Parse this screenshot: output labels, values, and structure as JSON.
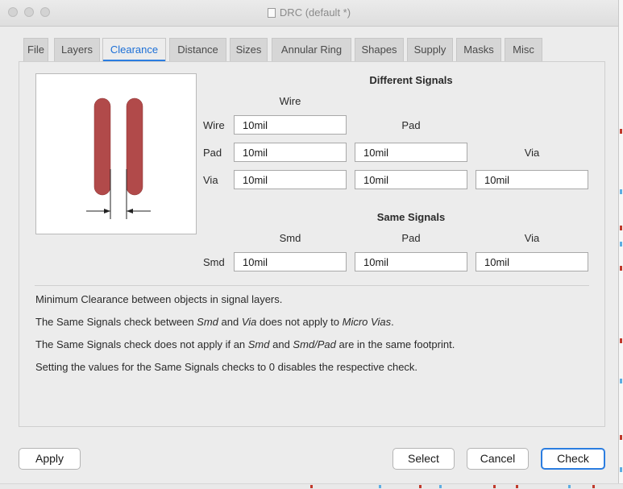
{
  "window": {
    "title": "DRC (default *)"
  },
  "tabs": [
    "File",
    "Layers",
    "Clearance",
    "Distance",
    "Sizes",
    "Annular Ring",
    "Shapes",
    "Supply",
    "Masks",
    "Misc"
  ],
  "active_tab": "Clearance",
  "different_signals": {
    "heading": "Different Signals",
    "col_wire": "Wire",
    "col_pad": "Pad",
    "col_via": "Via",
    "row_wire": "Wire",
    "row_pad": "Pad",
    "row_via": "Via",
    "wire_wire": "10mil",
    "pad_wire": "10mil",
    "pad_pad": "10mil",
    "via_wire": "10mil",
    "via_pad": "10mil",
    "via_via": "10mil"
  },
  "same_signals": {
    "heading": "Same Signals",
    "col_smd": "Smd",
    "col_pad": "Pad",
    "col_via": "Via",
    "row_smd": "Smd",
    "smd_smd": "10mil",
    "smd_pad": "10mil",
    "smd_via": "10mil"
  },
  "notes": {
    "line1": "Minimum Clearance between objects in signal layers.",
    "line2": {
      "a": "The Same Signals check between ",
      "b": "Smd",
      "c": " and ",
      "d": "Via",
      "e": " does not apply to ",
      "f": "Micro Vias",
      "g": "."
    },
    "line3": {
      "a": "The Same Signals check does not apply if an ",
      "b": "Smd",
      "c": " and ",
      "d": "Smd/Pad",
      "e": " are in the same footprint."
    },
    "line4": "Setting the values for the Same Signals checks to 0 disables the respective check."
  },
  "buttons": {
    "apply": "Apply",
    "select": "Select",
    "cancel": "Cancel",
    "check": "Check"
  },
  "colors": {
    "accent": "#2b7de0",
    "pad_fill": "#b14a4a"
  }
}
